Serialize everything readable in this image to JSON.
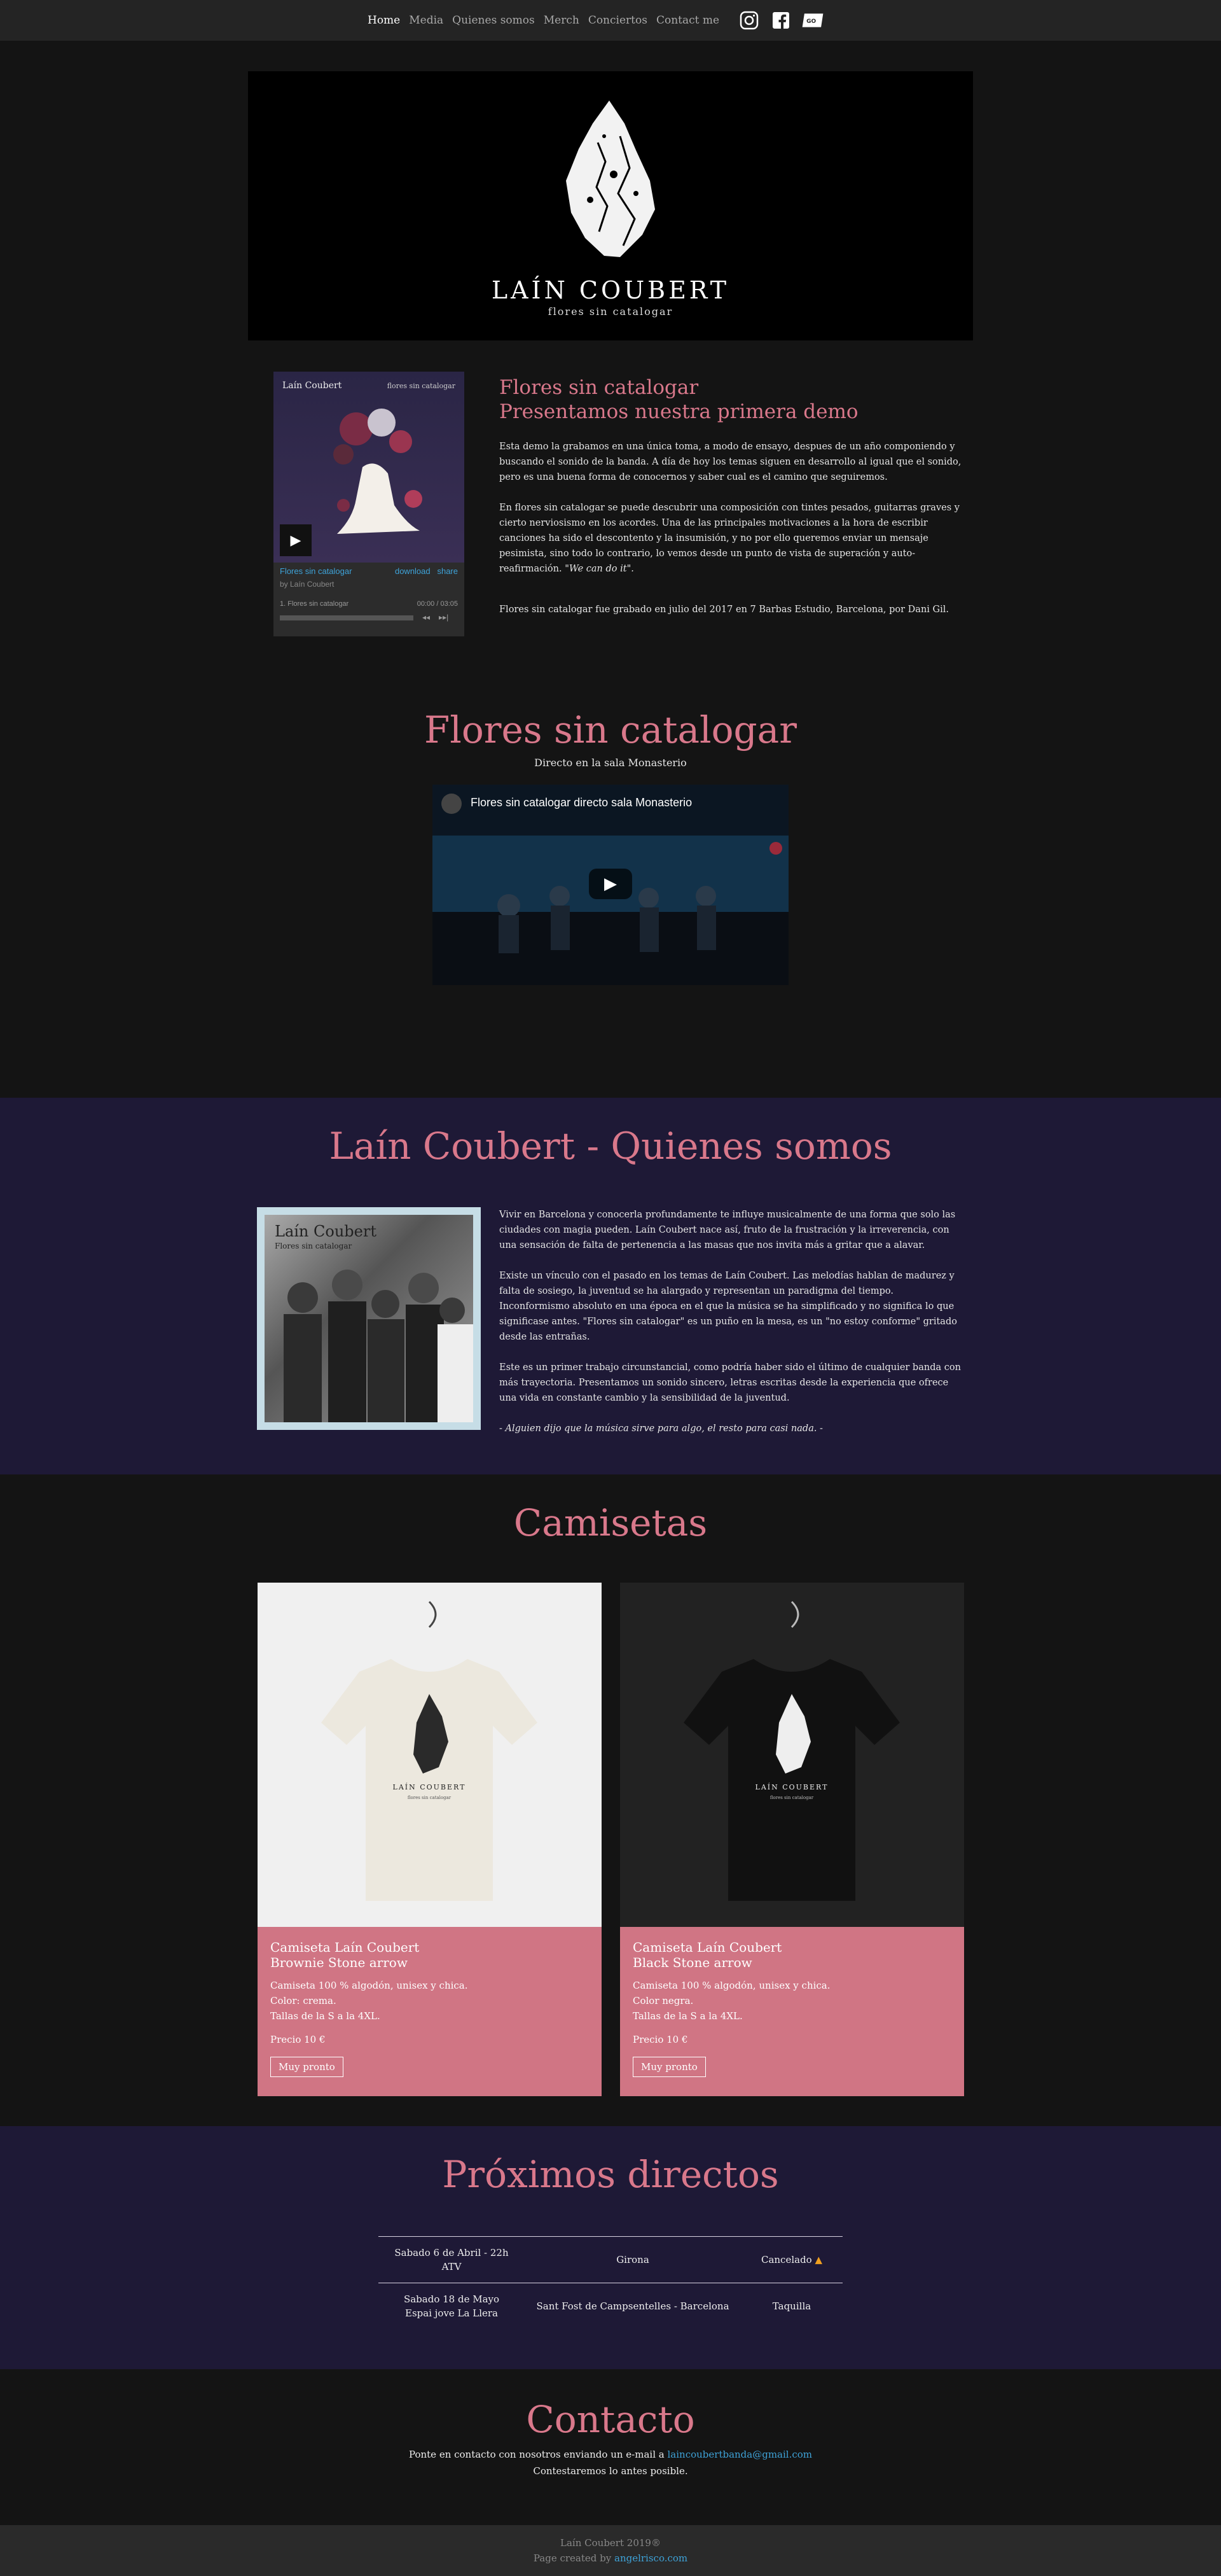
{
  "nav": {
    "items": [
      {
        "label": "Home"
      },
      {
        "label": "Media"
      },
      {
        "label": "Quienes somos"
      },
      {
        "label": "Merch"
      },
      {
        "label": "Conciertos"
      },
      {
        "label": "Contact me"
      }
    ],
    "social_icons": [
      "instagram-icon",
      "facebook-icon",
      "ticket-icon"
    ]
  },
  "hero": {
    "title": "LAÍN COUBERT",
    "subtitle": "flores sin catalogar"
  },
  "demo": {
    "player": {
      "art_band": "Laín Coubert",
      "art_album": "flores sin catalogar",
      "title": "Flores sin catalogar",
      "download": "download",
      "share": "share",
      "by": "by Laín Coubert",
      "track": "1. Flores sin catalogar",
      "time": "00:00 / 03:05"
    },
    "heading_1": "Flores sin catalogar",
    "heading_2": "Presentamos nuestra primera demo",
    "p1": "Esta demo la grabamos en una única toma, a modo de ensayo, despues de un año componiendo y buscando el sonido de la banda. A día de hoy los temas siguen en desarrollo al igual que el sonido, pero es una buena forma de conocernos y saber cual es el camino que seguiremos.",
    "p2": "En flores sin catalogar se puede descubrir una composición con tintes pesados, guitarras graves y cierto nerviosismo en los acordes. Una de las principales motivaciones a la hora de escribir canciones ha sido el descontento y la insumisión, y no por ello queremos enviar un mensaje pesimista, sino todo lo contrario, lo vemos desde un punto de vista de superación y auto-reafirmación.",
    "p2_quote": "\"We can do it\".",
    "p3": "Flores sin catalogar fue grabado en julio del 2017 en 7 Barbas Estudio, Barcelona, por Dani Gil."
  },
  "video": {
    "title": "Flores sin catalogar",
    "subtitle": "Directo en la sala Monasterio",
    "video_title": "Flores sin catalogar directo sala Monasterio"
  },
  "about": {
    "title": "Laín Coubert - Quienes somos",
    "photo_band": "Laín Coubert",
    "photo_album": "Flores sin catalogar",
    "p1": "Vivir en Barcelona y conocerla profundamente te influye musicalmente de una forma que solo las ciudades con magia pueden. Laín Coubert nace así, fruto de la frustración y la irreverencia, con una sensación de falta de pertenencia a las masas que nos invita más a gritar que a alavar.",
    "p2": "Existe un vínculo con el pasado en los temas de Laín Coubert. Las melodías hablan de madurez y falta de sosiego, la juventud se ha alargado y representan un paradigma del tiempo. Inconformismo absoluto en una época en el que la música se ha simplificado y no significa lo que significase antes. \"Flores sin catalogar\" es un puño en la mesa, es un \"no estoy conforme\" gritado desde las entrañas.",
    "p3": "Este es un primer trabajo circunstancial, como podría haber sido el último de cualquier banda con más trayectoria. Presentamos un sonido sincero, letras escritas desde la experiencia que ofrece una vida en constante cambio y la sensibilidad de la juventud.",
    "quote": "- Alguien dijo que la música sirve para algo, el resto para casi nada. -"
  },
  "shirts": {
    "title": "Camisetas",
    "items": [
      {
        "title_1": "Camiseta Laín Coubert",
        "title_2": "Brownie Stone arrow",
        "d1": "Camiseta 100 % algodón, unisex y chica.",
        "d2": "Color: crema.",
        "d3": "Tallas de la S a la 4XL.",
        "price": "Precio 10 €",
        "button": "Muy pronto",
        "print_band": "LAÍN COUBERT",
        "print_album": "flores sin catalogar"
      },
      {
        "title_1": "Camiseta Laín Coubert",
        "title_2": "Black Stone arrow",
        "d1": "Camiseta 100 % algodón, unisex y chica.",
        "d2": "Color negra.",
        "d3": "Tallas de la S a la 4XL.",
        "price": "Precio 10 €",
        "button": "Muy pronto",
        "print_band": "LAÍN COUBERT",
        "print_album": "flores sin catalogar"
      }
    ]
  },
  "gigs": {
    "title": "Próximos directos",
    "rows": [
      {
        "date": "Sabado 6 de Abril - 22h",
        "venue": "ATV",
        "city": "Girona",
        "status": "Cancelado"
      },
      {
        "date": "Sabado 18 de Mayo",
        "venue": "Espai jove La Llera",
        "city": "Sant Fost de Campsentelles - Barcelona",
        "status": "Taquilla"
      }
    ]
  },
  "contact": {
    "title": "Contacto",
    "line1": "Ponte en contacto con nosotros enviando un e-mail a",
    "email": "laincoubertbanda@gmail.com",
    "line2": "Contestaremos lo antes posible."
  },
  "footer": {
    "copyright": "Laín Coubert 2019®",
    "credit": "Page created by",
    "credit_link": "angelrisco.com"
  }
}
